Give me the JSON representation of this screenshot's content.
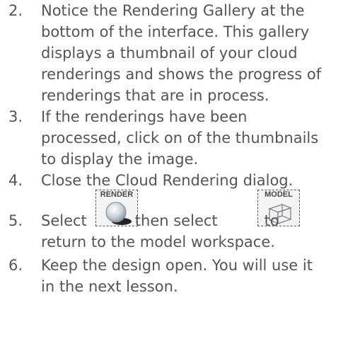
{
  "steps": [
    {
      "number": "2.",
      "lines": [
        "Notice the Rendering Gallery at the",
        "bottom of the interface. This gallery",
        "displays a thumbnail of your cloud",
        "renderings and shows the progress of",
        "renderings that are in process."
      ]
    },
    {
      "number": "3.",
      "lines": [
        "If the renderings have been",
        "processed, click on of the thumbnails",
        "to display the image."
      ]
    },
    {
      "number": "4.",
      "lines": [
        "Close the Cloud Rendering dialog."
      ]
    },
    {
      "number": "5.",
      "select_text": "Select",
      "then_select_text": "then select",
      "to_text": "to",
      "line2": "return to the model workspace.",
      "render_button": {
        "caption": "RENDER",
        "icon": "render-sphere-icon"
      },
      "model_button": {
        "caption": "MODEL",
        "icon": "model-cube-icon"
      }
    },
    {
      "number": "6.",
      "lines": [
        "Keep the design open. You will use it",
        "in the next lesson."
      ]
    }
  ]
}
